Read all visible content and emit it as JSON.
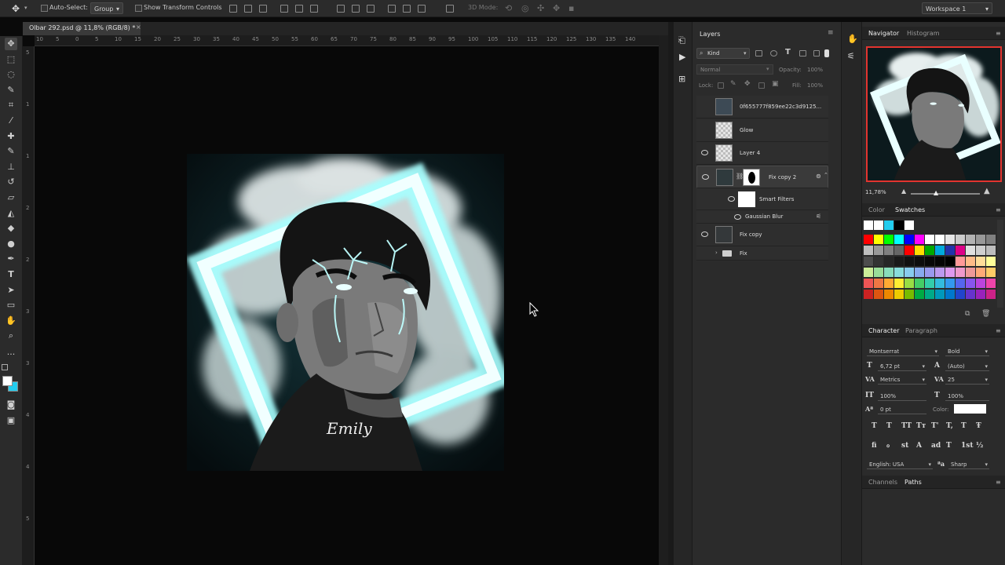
{
  "options_bar": {
    "auto_select_label": "Auto-Select:",
    "auto_select_value": "Group",
    "show_transform_label": "Show Transform Controls",
    "mode_3d_label": "3D Mode:",
    "workspace": "Workspace 1"
  },
  "document": {
    "tab_title": "Olbar 292.psd @ 11,8% (RGB/8) *",
    "ruler_h": [
      "10",
      "5",
      "0",
      "5",
      "10",
      "15",
      "20",
      "25",
      "30",
      "35",
      "40",
      "45",
      "50",
      "55",
      "60",
      "65",
      "70",
      "75",
      "80",
      "85",
      "90",
      "95",
      "100",
      "105",
      "110",
      "115",
      "120",
      "125",
      "130",
      "135",
      "140"
    ],
    "ruler_v": [
      "5",
      "1",
      "1",
      "2",
      "2",
      "3",
      "3",
      "4",
      "4",
      "5"
    ]
  },
  "layers": {
    "tab": "Layers",
    "filter": "Kind",
    "blend_mode": "Normal",
    "opacity_label": "Opacity:",
    "opacity_value": "100%",
    "lock_label": "Lock:",
    "fill_label": "Fill:",
    "fill_value": "100%",
    "items": [
      {
        "name": "0f655777f859ee22c3d9125...",
        "visible": false
      },
      {
        "name": "Glow",
        "visible": false
      },
      {
        "name": "Layer 4",
        "visible": true
      },
      {
        "name": "Fix copy 2",
        "visible": true
      },
      {
        "name": "Smart Filters",
        "visible": true
      },
      {
        "name": "Gaussian Blur",
        "visible": true
      },
      {
        "name": "Fix copy",
        "visible": true
      },
      {
        "name": "Fix",
        "visible": false
      }
    ]
  },
  "navigator": {
    "tab_active": "Navigator",
    "tab_inactive": "Histogram",
    "zoom": "11,78%",
    "frame_color": "#e3342f"
  },
  "swatches": {
    "tab_inactive": "Color",
    "tab_active": "Swatches",
    "rows": [
      [
        "#ffffff",
        "#ffffff",
        "#22ccee",
        "#000000",
        "#ffffff"
      ],
      [
        "#ff0000",
        "#ffff00",
        "#00ff00",
        "#00ffff",
        "#0000ff",
        "#ff00ff",
        "#ffffff",
        "#ffffff",
        "#e6e6e6",
        "#cccccc",
        "#b3b3b3",
        "#999999",
        "#808080"
      ],
      [
        "#bfbfbf",
        "#999999",
        "#808080",
        "#666666",
        "#ff0000",
        "#ffdd00",
        "#00aa00",
        "#00aadd",
        "#2233aa",
        "#dd0088",
        "#e0e0e0",
        "#cfcfcf",
        "#bdbdbd"
      ],
      [
        "#4d4d4d",
        "#333333",
        "#262626",
        "#1a1a1a",
        "#111111",
        "#0d0d0d",
        "#080808",
        "#050505",
        "#000000",
        "#ff9999",
        "#ffbb88",
        "#ffdd99",
        "#ffff99"
      ],
      [
        "#ccee99",
        "#99dd99",
        "#88ddbb",
        "#88dddd",
        "#88ccee",
        "#88aaee",
        "#9999ee",
        "#bb99ee",
        "#dd99ee",
        "#ee99cc",
        "#ee9999",
        "#ffaa77",
        "#ffcc66"
      ],
      [
        "#ee5555",
        "#ee7744",
        "#ffaa33",
        "#ffee33",
        "#99dd44",
        "#44cc66",
        "#33ccaa",
        "#33bbdd",
        "#3399ee",
        "#5566ee",
        "#8855ee",
        "#bb44dd",
        "#ee44aa"
      ],
      [
        "#cc2222",
        "#dd5511",
        "#ee8800",
        "#eecc00",
        "#77bb00",
        "#00aa44",
        "#00aa88",
        "#0099bb",
        "#0077cc",
        "#2244cc",
        "#6633cc",
        "#9922bb",
        "#cc2288"
      ]
    ]
  },
  "character": {
    "tab_active": "Character",
    "tab_inactive": "Paragraph",
    "font_family": "Montserrat",
    "font_style": "Bold",
    "font_size": "6,72 pt",
    "leading": "(Auto)",
    "kerning": "Metrics",
    "tracking": "25",
    "vscale": "100%",
    "hscale": "100%",
    "baseline": "0 pt",
    "color_label": "Color:",
    "language": "English: USA",
    "antialias": "Sharp",
    "style_glyphs": [
      "T",
      "T",
      "TT",
      "Tт",
      "T'",
      "T,",
      "T",
      "Ŧ"
    ],
    "ot_glyphs": [
      "fi",
      "ℴ",
      "st",
      "A",
      "ad",
      "T",
      "1st",
      "½"
    ]
  },
  "paths_panel": {
    "tab_inactive": "Channels",
    "tab_active": "Paths"
  },
  "artwork": {
    "signature": "Emily"
  }
}
